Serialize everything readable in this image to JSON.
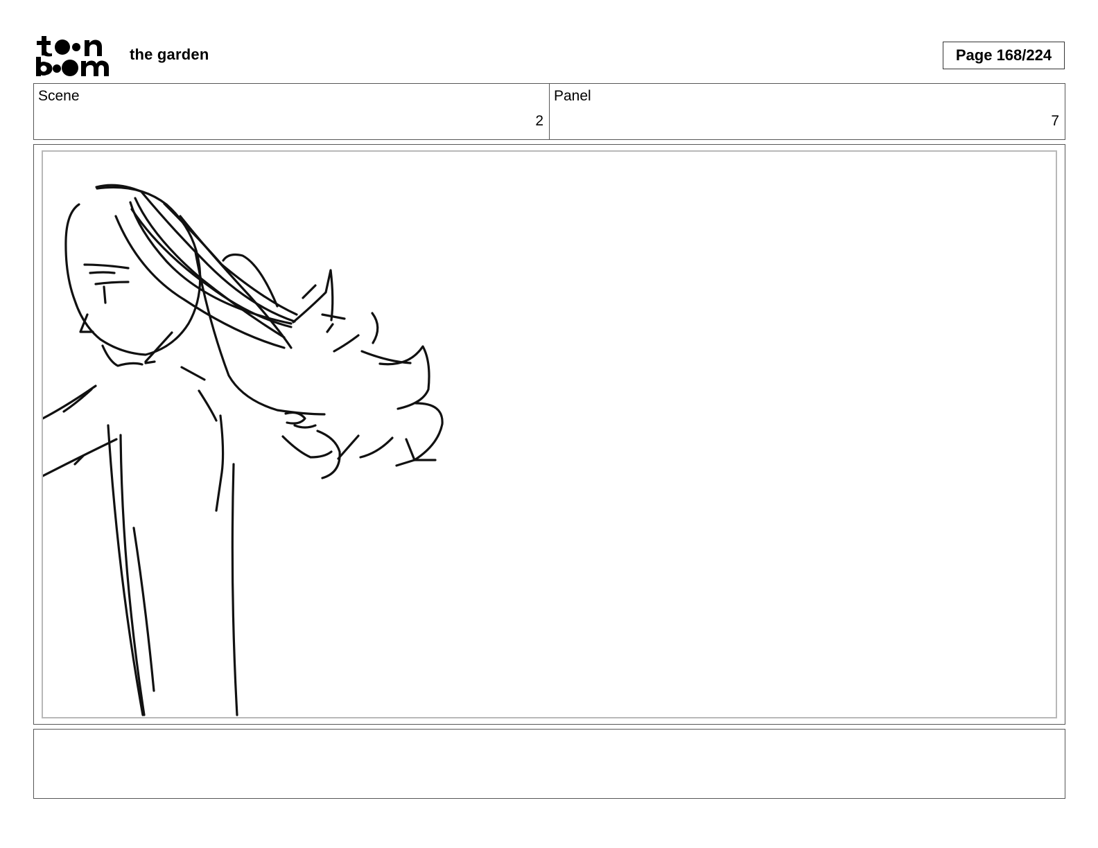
{
  "header": {
    "logo": {
      "line1": "toon",
      "line2": "boom"
    },
    "project_title": "the garden",
    "page_counter": "Page 168/224"
  },
  "info": {
    "scene_label": "Scene",
    "scene_value": "2",
    "panel_label": "Panel",
    "panel_value": "7"
  },
  "drawing": {
    "subject": "rough sketch of a figure with long windblown hair"
  },
  "caption": {
    "text": ""
  }
}
